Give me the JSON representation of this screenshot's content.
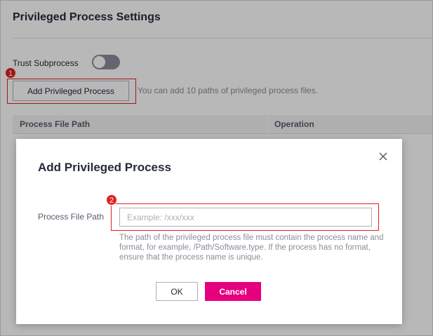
{
  "page": {
    "title": "Privileged Process Settings",
    "trust_subprocess_label": "Trust Subprocess",
    "trust_subprocess_enabled": false,
    "add_button_label": "Add Privileged Process",
    "hint": "You can add 10 paths of privileged process files.",
    "table": {
      "columns": [
        "Process File Path",
        "Operation"
      ]
    }
  },
  "annotations": {
    "badge_1": "1",
    "badge_2": "2",
    "highlight_color": "#e02020"
  },
  "dialog": {
    "title": "Add Privileged Process",
    "close_icon": "close-icon",
    "field_label": "Process File Path",
    "field_value": "",
    "field_placeholder": "Example: /xxx/xxx",
    "help_text": "The path of the privileged process file must contain the process name and format, for example, /Path/Software.type. If the process has no format, ensure that the process name is unique.",
    "ok_label": "OK",
    "cancel_label": "Cancel"
  },
  "colors": {
    "accent": "#e6007e",
    "toggle_off": "#8a8e99"
  }
}
